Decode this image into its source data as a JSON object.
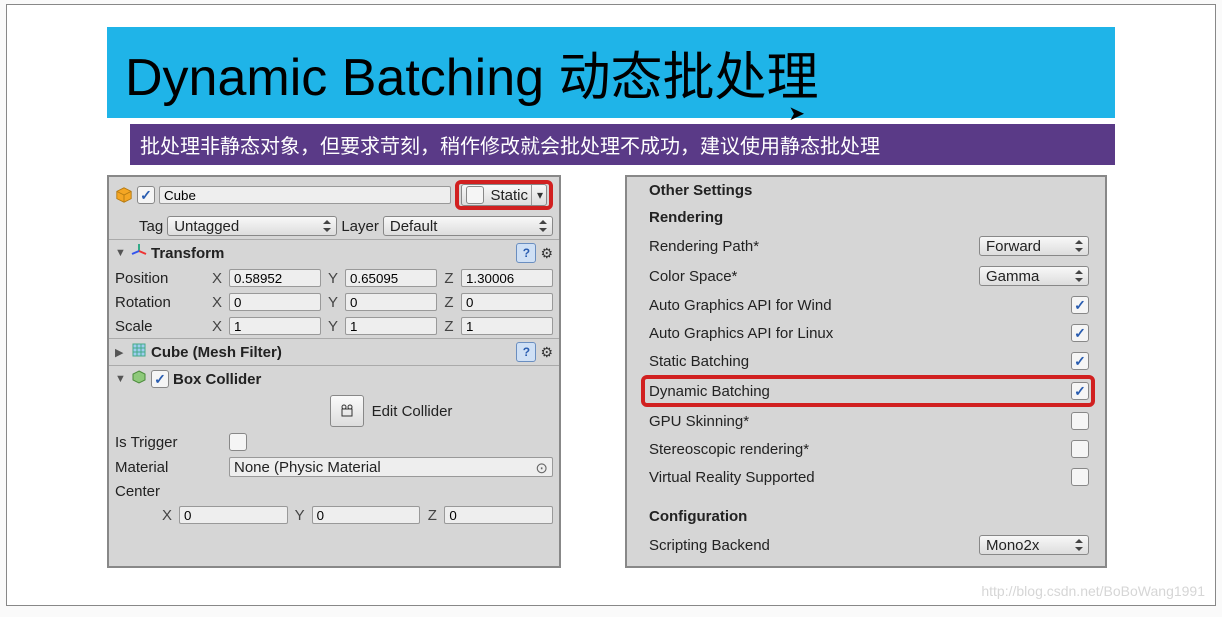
{
  "title": "Dynamic Batching 动态批处理",
  "subtitle": "批处理非静态对象，但要求苛刻，稍作修改就会批处理不成功，建议使用静态批处理",
  "inspector": {
    "object_name": "Cube",
    "static_label": "Static",
    "tag_label": "Tag",
    "tag_value": "Untagged",
    "layer_label": "Layer",
    "layer_value": "Default",
    "transform_label": "Transform",
    "pos_label": "Position",
    "rot_label": "Rotation",
    "scale_label": "Scale",
    "pos": {
      "x": "0.58952",
      "y": "0.65095",
      "z": "1.30006"
    },
    "rot": {
      "x": "0",
      "y": "0",
      "z": "0"
    },
    "scale": {
      "x": "1",
      "y": "1",
      "z": "1"
    },
    "mesh_filter_label": "Cube (Mesh Filter)",
    "box_collider_label": "Box Collider",
    "edit_collider_label": "Edit Collider",
    "is_trigger_label": "Is Trigger",
    "material_label": "Material",
    "material_value": "None (Physic Material",
    "center_label": "Center",
    "center": {
      "x": "0",
      "y": "0",
      "z": "0"
    }
  },
  "settings": {
    "other_header": "Other Settings",
    "rendering_header": "Rendering",
    "rendering_path_label": "Rendering Path*",
    "rendering_path_value": "Forward",
    "color_space_label": "Color Space*",
    "color_space_value": "Gamma",
    "auto_win_label": "Auto Graphics API for Wind",
    "auto_linux_label": "Auto Graphics API for Linux",
    "static_batch_label": "Static Batching",
    "dynamic_batch_label": "Dynamic Batching",
    "gpu_skinning_label": "GPU Skinning*",
    "stereo_label": "Stereoscopic rendering*",
    "vr_label": "Virtual Reality Supported",
    "config_header": "Configuration",
    "backend_label": "Scripting Backend",
    "backend_value": "Mono2x"
  },
  "watermark": "http://blog.csdn.net/BoBoWang1991"
}
